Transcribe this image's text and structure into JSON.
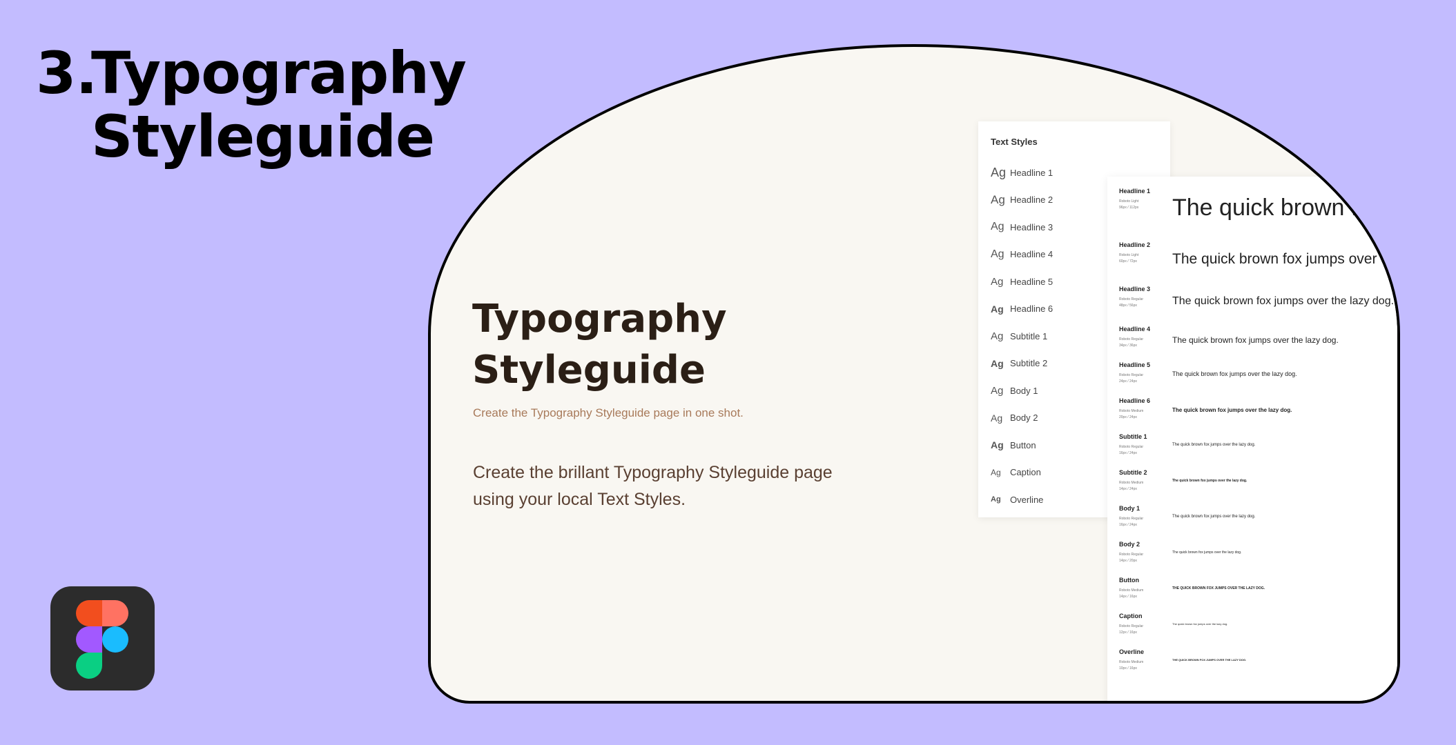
{
  "page": {
    "title_number": "3.",
    "title_line1": "Typography",
    "title_line2": "Styleguide"
  },
  "brand": {
    "logo": "figma-logo",
    "colors": {
      "background": "#c3bcff",
      "card": "#f9f7f2",
      "tile": "#2c2c2c"
    }
  },
  "card": {
    "title": "Typography Styleguide",
    "subtitle": "Create the Typography Styleguide page in one shot.",
    "description": "Create the brillant Typography Styleguide page using your local Text Styles."
  },
  "text_styles_panel": {
    "title": "Text Styles",
    "items": [
      {
        "ag": "Ag",
        "label": "Headline 1"
      },
      {
        "ag": "Ag",
        "label": "Headline 2"
      },
      {
        "ag": "Ag",
        "label": "Headline 3"
      },
      {
        "ag": "Ag",
        "label": "Headline 4"
      },
      {
        "ag": "Ag",
        "label": "Headline 5"
      },
      {
        "ag": "Ag",
        "label": "Headline 6"
      },
      {
        "ag": "Ag",
        "label": "Subtitle 1"
      },
      {
        "ag": "Ag",
        "label": "Subtitle 2"
      },
      {
        "ag": "Ag",
        "label": "Body 1"
      },
      {
        "ag": "Ag",
        "label": "Body 2"
      },
      {
        "ag": "Ag",
        "label": "Button"
      },
      {
        "ag": "Ag",
        "label": "Caption"
      },
      {
        "ag": "Ag",
        "label": "Overline"
      }
    ]
  },
  "specimen": {
    "rows": [
      {
        "name": "Headline 1",
        "meta1": "Roboto Light",
        "meta2": "96px / 112px",
        "sample": "The quick brown fox jumps over the lazy dog."
      },
      {
        "name": "Headline 2",
        "meta1": "Roboto Light",
        "meta2": "60px / 72px",
        "sample": "The quick brown fox jumps over the lazy dog."
      },
      {
        "name": "Headline 3",
        "meta1": "Roboto Regular",
        "meta2": "48px / 56px",
        "sample": "The quick brown fox jumps over the lazy dog."
      },
      {
        "name": "Headline 4",
        "meta1": "Roboto Regular",
        "meta2": "34px / 36px",
        "sample": "The quick brown fox jumps over the lazy dog."
      },
      {
        "name": "Headline 5",
        "meta1": "Roboto Regular",
        "meta2": "24px / 24px",
        "sample": "The quick brown fox jumps over the lazy dog."
      },
      {
        "name": "Headline 6",
        "meta1": "Roboto Medium",
        "meta2": "20px / 24px",
        "sample": "The quick brown fox jumps over the lazy dog."
      },
      {
        "name": "Subtitle 1",
        "meta1": "Roboto Regular",
        "meta2": "16px / 24px",
        "sample": "The quick brown fox jumps over the lazy dog."
      },
      {
        "name": "Subtitle 2",
        "meta1": "Roboto Medium",
        "meta2": "14px / 24px",
        "sample": "The quick brown fox jumps over the lazy dog."
      },
      {
        "name": "Body 1",
        "meta1": "Roboto Regular",
        "meta2": "16px / 24px",
        "sample": "The quick brown fox jumps over the lazy dog."
      },
      {
        "name": "Body 2",
        "meta1": "Roboto Regular",
        "meta2": "14px / 20px",
        "sample": "The quick brown fox jumps over the lazy dog."
      },
      {
        "name": "Button",
        "meta1": "Roboto Medium",
        "meta2": "14px / 16px",
        "sample": "THE QUICK BROWN FOX JUMPS OVER THE LAZY DOG."
      },
      {
        "name": "Caption",
        "meta1": "Roboto Regular",
        "meta2": "12px / 16px",
        "sample": "The quick brown fox jumps over the lazy dog."
      },
      {
        "name": "Overline",
        "meta1": "Roboto Medium",
        "meta2": "10px / 16px",
        "sample": "THE QUICK BROWN FOX JUMPS OVER THE LAZY DOG."
      }
    ]
  }
}
